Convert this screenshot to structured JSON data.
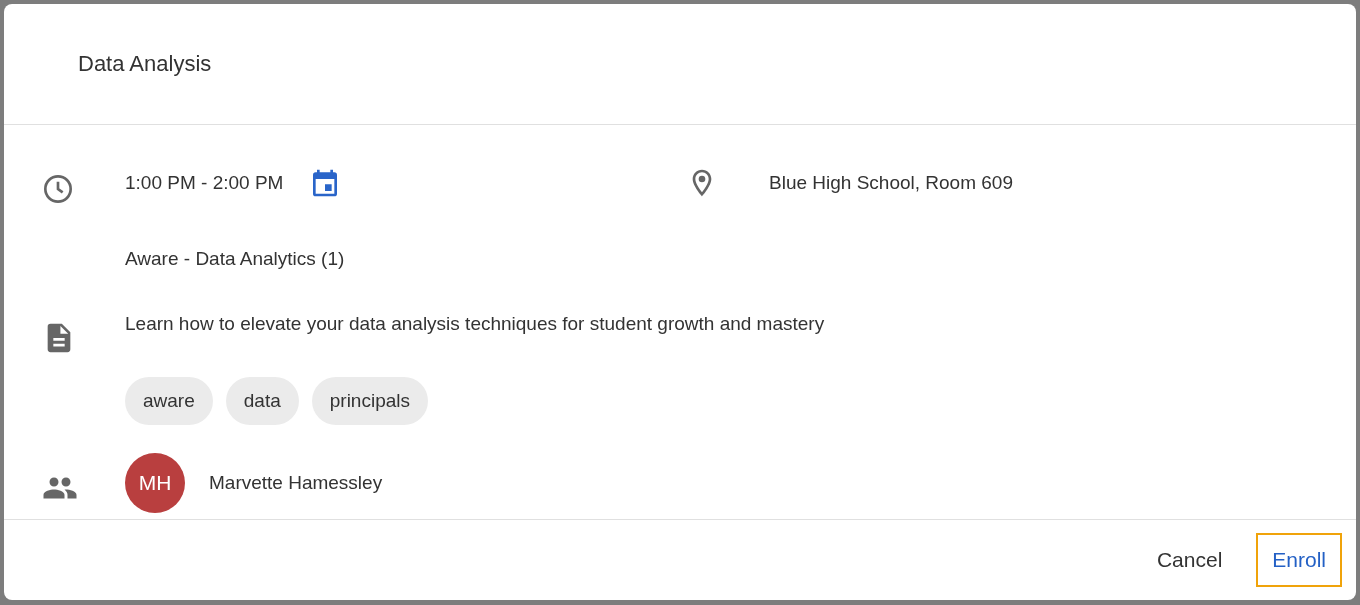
{
  "dialog": {
    "title": "Data Analysis",
    "time": "1:00 PM - 2:00 PM",
    "location": "Blue High School, Room 609",
    "course": "Aware - Data Analytics (1)",
    "description": "Learn how to elevate your data analysis techniques for student growth and mastery",
    "tags": [
      "aware",
      "data",
      "principals"
    ],
    "people": [
      {
        "initials": "MH",
        "name": "Marvette Hamessley"
      }
    ],
    "buttons": [
      {
        "label": "Cancel",
        "kind": "text",
        "focused": false
      },
      {
        "label": "Enroll",
        "kind": "primary",
        "focused": true
      }
    ]
  }
}
